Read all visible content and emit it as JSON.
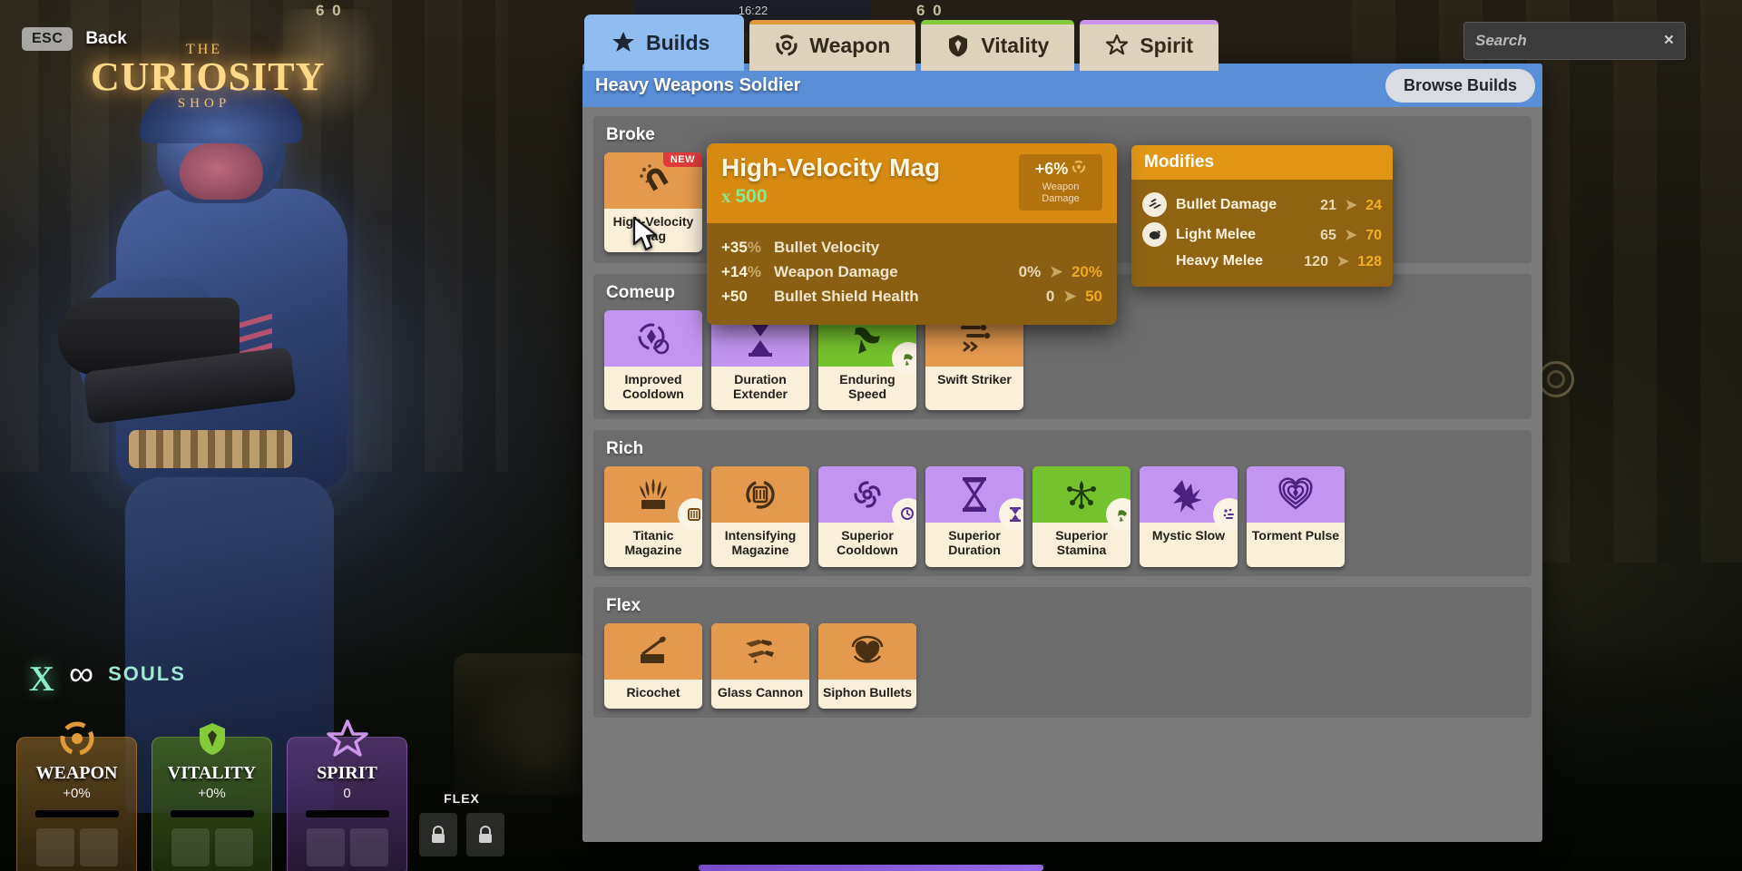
{
  "hud": {
    "esc_key": "ESC",
    "back_label": "Back",
    "logo_the": "THE",
    "logo_main": "CURIOSITY",
    "logo_shop": "SHOP",
    "souls_count": "∞",
    "souls_label": "SOULS",
    "flex_label": "FLEX",
    "clock": "16:22",
    "score_left": "6 0",
    "score_right": "6 0",
    "stats": [
      {
        "name": "WEAPON",
        "value": "+0%",
        "icon": "weapon-orbit-icon",
        "color": "#e09a3a"
      },
      {
        "name": "VITALITY",
        "value": "+0%",
        "icon": "vitality-shield-icon",
        "color": "#84c93a"
      },
      {
        "name": "SPIRIT",
        "value": "0",
        "icon": "spirit-star-icon",
        "color": "#cb95ec"
      }
    ]
  },
  "tabs": [
    {
      "label": "Builds",
      "icon": "star-filled-icon",
      "active": true
    },
    {
      "label": "Weapon",
      "icon": "weapon-orbit-icon",
      "active": false
    },
    {
      "label": "Vitality",
      "icon": "shield-icon",
      "active": false
    },
    {
      "label": "Spirit",
      "icon": "star-outline-icon",
      "active": false
    }
  ],
  "search": {
    "placeholder": "Search",
    "value": "",
    "clear_icon": "close-icon"
  },
  "panel": {
    "title": "Heavy Weapons Soldier",
    "browse_label": "Browse Builds"
  },
  "sections": [
    {
      "title": "Broke",
      "items": [
        {
          "name": "High-Velocity Mag",
          "art": "orange",
          "icon": "magnet-burst-icon",
          "badge": "NEW",
          "corner": null
        },
        {
          "name": "",
          "art": "green",
          "icon": "hidden-icon",
          "badge": null,
          "corner": null
        }
      ]
    },
    {
      "title": "Comeup",
      "items": [
        {
          "name": "Improved Cooldown",
          "art": "purple",
          "icon": "cooldown-cycle-icon",
          "badge": null,
          "corner": null
        },
        {
          "name": "Duration Extender",
          "art": "purple",
          "icon": "hourglass-icon",
          "badge": null,
          "corner": null
        },
        {
          "name": "Enduring Speed",
          "art": "green",
          "icon": "running-boot-icon",
          "badge": null,
          "corner": "stamina-icon"
        },
        {
          "name": "Swift Striker",
          "art": "orange",
          "icon": "bullet-trail-icon",
          "badge": null,
          "corner": null
        }
      ]
    },
    {
      "title": "Rich",
      "items": [
        {
          "name": "Titanic Magazine",
          "art": "orange",
          "icon": "wheat-crown-icon",
          "badge": null,
          "corner": "magazine-icon"
        },
        {
          "name": "Intensifying Magazine",
          "art": "orange",
          "icon": "magazine-cycle-icon",
          "badge": null,
          "corner": null
        },
        {
          "name": "Superior Cooldown",
          "art": "purple",
          "icon": "swirl-icon",
          "badge": null,
          "corner": "cooldown-icon"
        },
        {
          "name": "Superior Duration",
          "art": "purple",
          "icon": "hourglass-ornate-icon",
          "badge": null,
          "corner": "hourglass-icon"
        },
        {
          "name": "Superior Stamina",
          "art": "green",
          "icon": "burst-node-icon",
          "badge": null,
          "corner": "stamina-icon"
        },
        {
          "name": "Mystic Slow",
          "art": "purple",
          "icon": "slow-hand-icon",
          "badge": null,
          "corner": "bullet-icon"
        },
        {
          "name": "Torment Pulse",
          "art": "purple",
          "icon": "heart-pulse-icon",
          "badge": null,
          "corner": null
        }
      ]
    },
    {
      "title": "Flex",
      "items": [
        {
          "name": "Ricochet",
          "art": "orange",
          "icon": "ricochet-icon",
          "badge": null,
          "corner": null
        },
        {
          "name": "Glass Cannon",
          "art": "orange",
          "icon": "shattered-bullets-icon",
          "badge": null,
          "corner": null
        },
        {
          "name": "Siphon Bullets",
          "art": "orange",
          "icon": "siphon-heart-icon",
          "badge": null,
          "corner": null
        }
      ]
    }
  ],
  "tooltip": {
    "title": "High-Velocity Mag",
    "cost": "500",
    "cost_icon": "souls-coin-icon",
    "badge_value": "+6%",
    "badge_icon": "weapon-orbit-icon",
    "badge_label": "Weapon Damage",
    "stats": [
      {
        "amount": "+35",
        "unit": "%",
        "name": "Bullet Velocity",
        "from": "",
        "to": ""
      },
      {
        "amount": "+14",
        "unit": "%",
        "name": "Weapon Damage",
        "from": "0%",
        "to": "20%"
      },
      {
        "amount": "+50",
        "unit": "",
        "name": "Bullet Shield Health",
        "from": "0",
        "to": "50"
      }
    ]
  },
  "modifies": {
    "title": "Modifies",
    "rows": [
      {
        "icon": "bullet-damage-icon",
        "name": "Bullet Damage",
        "from": "21",
        "to": "24",
        "indent": false
      },
      {
        "icon": "melee-fist-icon",
        "name": "Light Melee",
        "from": "65",
        "to": "70",
        "indent": false
      },
      {
        "icon": null,
        "name": "Heavy Melee",
        "from": "120",
        "to": "128",
        "indent": true
      }
    ]
  },
  "colors": {
    "accent_blue": "#5a8fd8",
    "tab_active": "#8fbdf0",
    "orange": "#e49a4e",
    "purple": "#c295f0",
    "green": "#74c22e",
    "tooltip_head": "#d68a12",
    "tooltip_body": "#8a5f13",
    "gold": "#f2a81e",
    "souls_green": "#8ce68c"
  }
}
